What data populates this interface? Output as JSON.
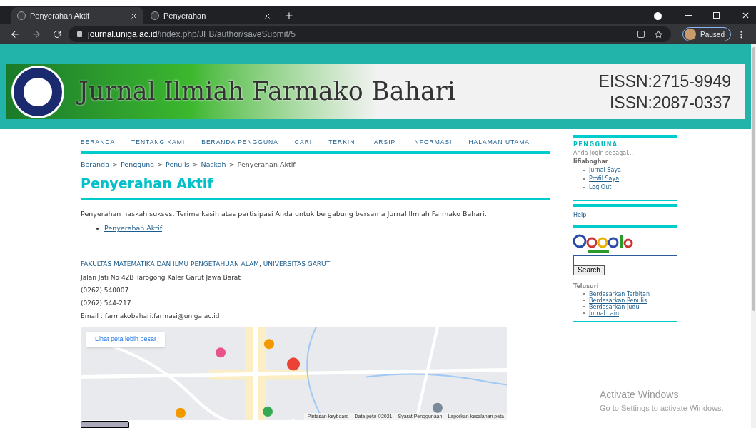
{
  "browser": {
    "tabs": [
      {
        "title": "Penyerahan Aktif",
        "selected": true
      },
      {
        "title": "Penyerahan",
        "selected": false
      }
    ],
    "url_host": "journal.uniga.ac.id",
    "url_path": "/index.php/JFB/author/saveSubmit/5",
    "profile": "Paused"
  },
  "banner": {
    "title": "Jurnal Ilmiah Farmako Bahari",
    "eissn": "EISSN:2715-9949",
    "issn": "ISSN:2087-0337"
  },
  "nav": [
    "BERANDA",
    "TENTANG KAMI",
    "BERANDA PENGGUNA",
    "CARI",
    "TERKINI",
    "ARSIP",
    "INFORMASI",
    "HALAMAN UTAMA"
  ],
  "breadcrumb": {
    "links": [
      "Beranda",
      "Pengguna",
      "Penulis",
      "Naskah"
    ],
    "separator": ">",
    "current": "Penyerahan Aktif"
  },
  "heading": "Penyerahan Aktif",
  "message": "Penyerahan naskah sukses. Terima kasih atas partisipasi Anda untuk bergabung bersama Jurnal Ilmiah Farmako Bahari.",
  "message_links": [
    "Penyerahan Aktif"
  ],
  "footer": {
    "links": [
      "FAKULTAS MATEMATIKA DAN ILMU PENGETAHUAN ALAM",
      "UNIVERSITAS GARUT"
    ],
    "separator": ",",
    "lines": [
      "Jalan Jati No 42B Tarogong Kaler Garut Jawa Barat",
      "(0262) 540007",
      "(0262) 544-217",
      "Email : farmakobahari.farmasi@uniga.ac.id"
    ]
  },
  "map": {
    "kind": "picture",
    "button": "Lihat peta lebih besar",
    "attribution": [
      "Pintasan keyboard",
      "Data peta ©2021",
      "Syarat Penggunaan",
      "Laporkan kesalahan peta"
    ]
  },
  "sidebar": {
    "user_title": "PENGGUNA",
    "login_note": "Anda login sebagai...",
    "username": "lifiaboghar",
    "user_links": [
      "Jurnal Saya",
      "Profil Saya",
      "Log Out"
    ],
    "help": "Help",
    "search_button": "Search",
    "browse_title": "Telusuri",
    "browse_links": [
      "Berdasarkan Terbitan",
      "Berdasarkan Penulis",
      "Berdasarkan Judul",
      "Jurnal Lain"
    ]
  },
  "os_watermark": {
    "title": "Activate Windows",
    "subtitle": "Go to Settings to activate Windows."
  }
}
